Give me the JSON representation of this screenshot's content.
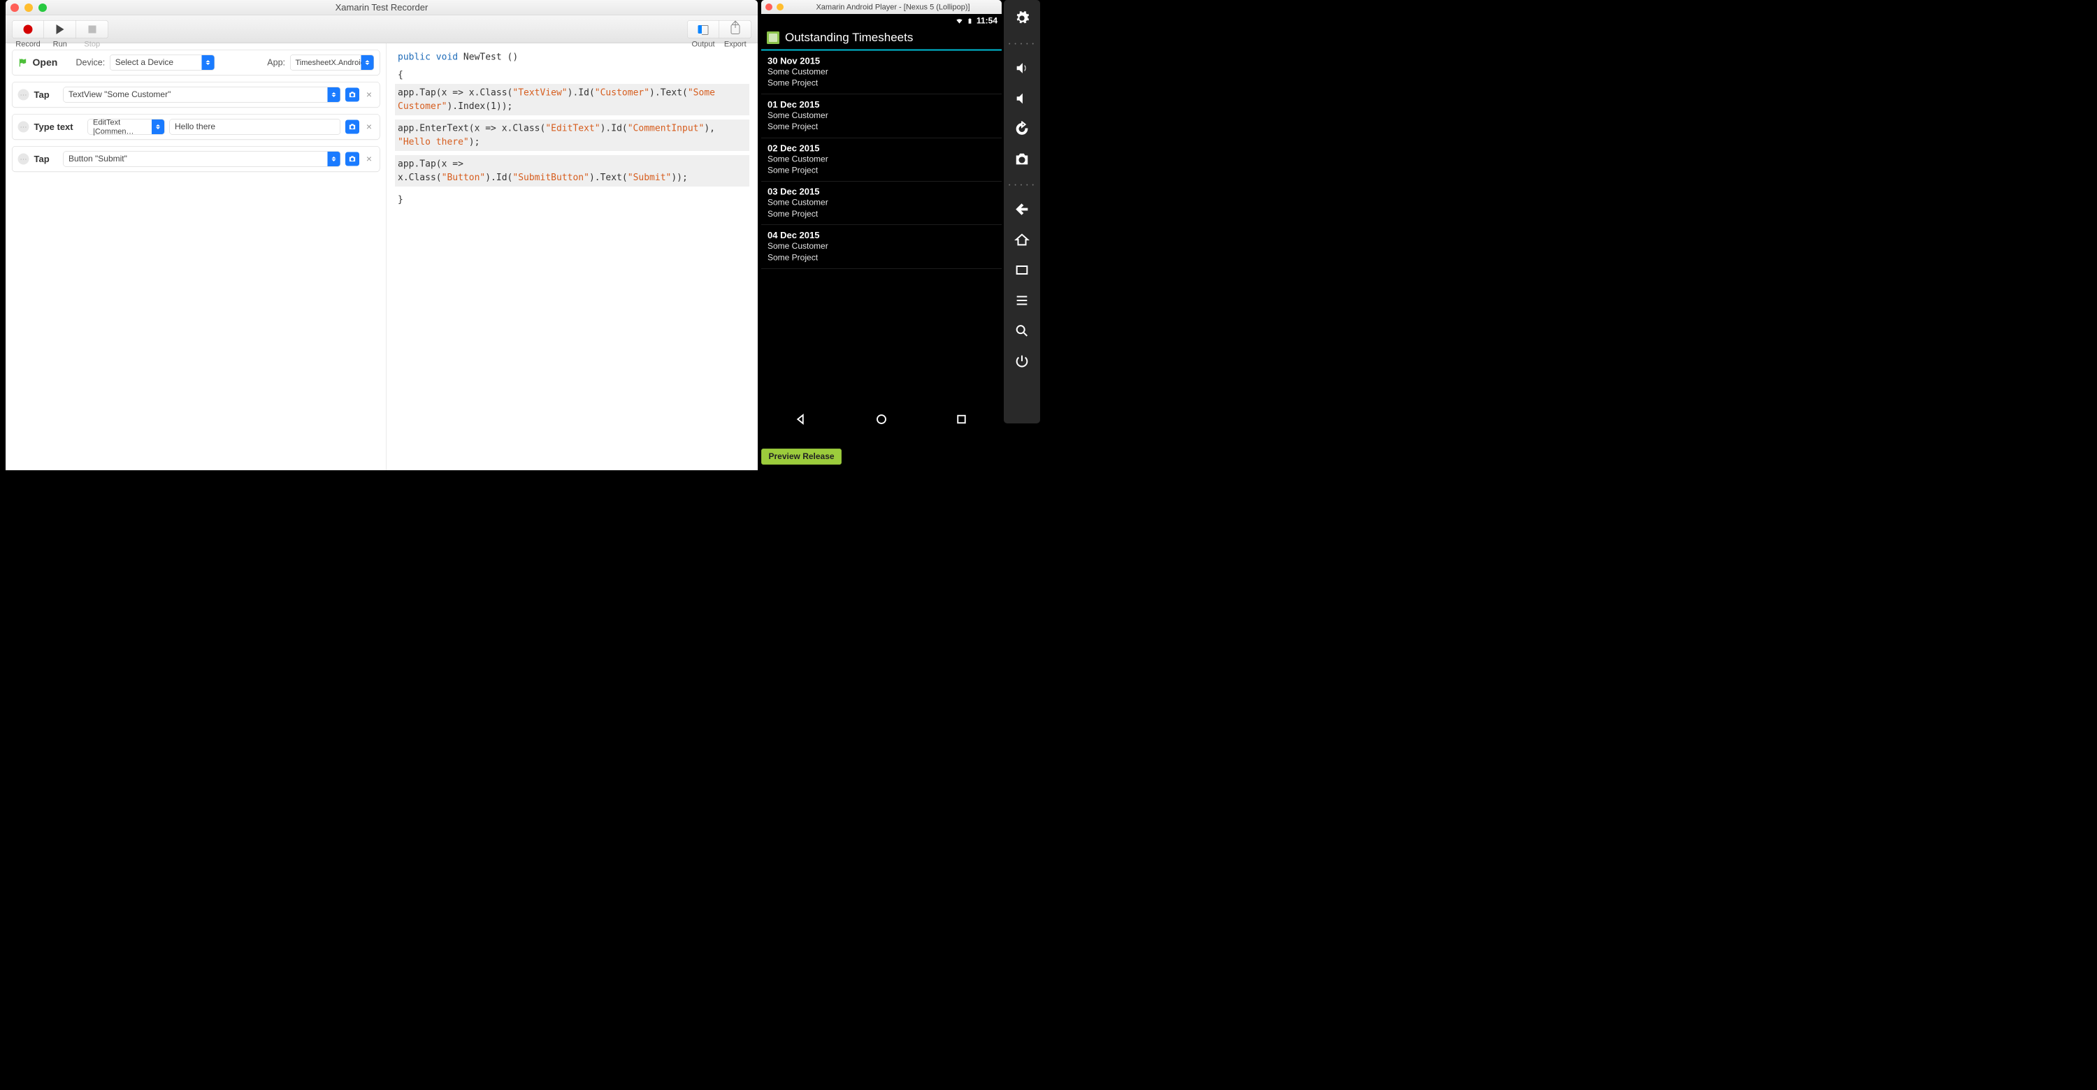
{
  "recorder": {
    "title": "Xamarin Test Recorder",
    "toolbar": {
      "record": "Record",
      "run": "Run",
      "stop": "Stop",
      "output": "Output",
      "export": "Export"
    },
    "openRow": {
      "label": "Open",
      "deviceLabel": "Device:",
      "deviceValue": "Select a Device",
      "appLabel": "App:",
      "appValue": "TimesheetX.Android…"
    },
    "steps": [
      {
        "action": "Tap",
        "selector": "TextView \"Some Customer\""
      },
      {
        "action": "Type text",
        "selector": "EditText |Commen…",
        "input": "Hello there"
      },
      {
        "action": "Tap",
        "selector": "Button \"Submit\""
      }
    ],
    "code": {
      "sig_pre": "public void",
      "sig_name": " NewTest ()",
      "l1a": "    app.Tap(x => x.Class(",
      "l1s1": "\"TextView\"",
      "l1b": ").Id(",
      "l1s2": "\"Customer\"",
      "l1c": ").Text(",
      "l1s3": "\"Some Customer\"",
      "l1d": ").Index(1));",
      "l2a": "    app.EnterText(x => x.Class(",
      "l2s1": "\"EditText\"",
      "l2b": ").Id(",
      "l2s2": "\"CommentInput\"",
      "l2c": "), ",
      "l2s3": "\"Hello there\"",
      "l2d": ");",
      "l3a": "    app.Tap(x => x.Class(",
      "l3s1": "\"Button\"",
      "l3b": ").Id(",
      "l3s2": "\"SubmitButton\"",
      "l3c": ").Text(",
      "l3s3": "\"Submit\"",
      "l3d": "));"
    }
  },
  "player": {
    "title": "Xamarin Android Player - [Nexus 5 (Lollipop)]",
    "clock": "11:54",
    "appTitle": "Outstanding Timesheets",
    "items": [
      {
        "date": "30 Nov 2015",
        "customer": "Some Customer",
        "project": "Some Project"
      },
      {
        "date": "01 Dec 2015",
        "customer": "Some Customer",
        "project": "Some Project"
      },
      {
        "date": "02 Dec 2015",
        "customer": "Some Customer",
        "project": "Some Project"
      },
      {
        "date": "03 Dec 2015",
        "customer": "Some Customer",
        "project": "Some Project"
      },
      {
        "date": "04 Dec 2015",
        "customer": "Some Customer",
        "project": "Some Project"
      }
    ],
    "previewChip": "Preview Release"
  }
}
